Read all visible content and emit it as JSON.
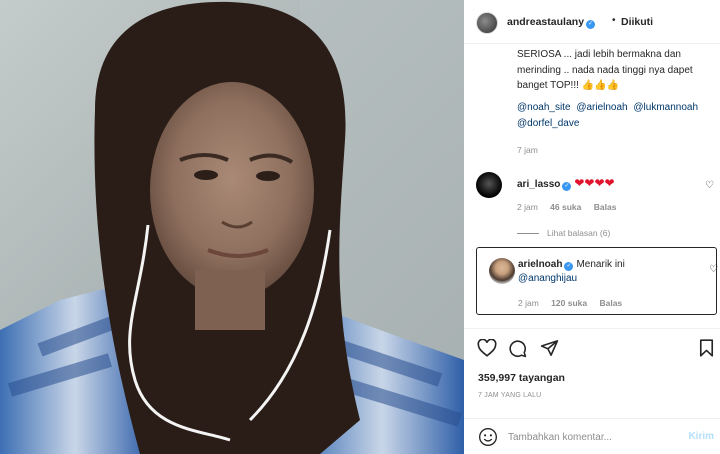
{
  "post": {
    "username": "andreastaulany",
    "separator": "•",
    "follow_status": "Diikuti",
    "caption": "SERIOSA ... jadi lebih bermakna dan merinding .. nada nada tinggi nya dapet banget TOP!!! 👍👍👍",
    "mentions": [
      "@noah_site",
      "@arielnoah",
      "@lukmannoah",
      "@dorfel_dave"
    ],
    "caption_time": "7 jam",
    "views": "359,997 tayangan",
    "posted_time": "7 JAM YANG LALU"
  },
  "comments": [
    {
      "username": "ari_lasso",
      "text": "❤❤❤❤",
      "time": "2 jam",
      "likes": "46 suka",
      "reply": "Balas",
      "view_replies": "Lihat balasan (6)"
    },
    {
      "username": "arielnoah",
      "text": "Menarik ini",
      "mention": "@ananghijau",
      "time": "2 jam",
      "likes": "120 suka",
      "reply": "Balas"
    }
  ],
  "add_comment": {
    "placeholder": "Tambahkan komentar...",
    "post_label": "Kirim"
  },
  "colors": {
    "verified": "#3897f0",
    "link": "#00376b",
    "muted": "#8e8e8e",
    "heart": "#e0142d",
    "post_disabled": "#b2dffc"
  }
}
